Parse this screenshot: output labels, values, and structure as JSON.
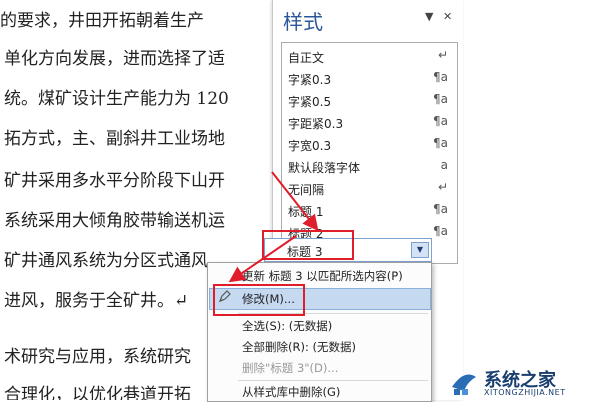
{
  "document": {
    "lines": [
      "的要求，井田开拓朝着生产",
      "单化方向发展，进而选择了适",
      "统。煤矿设计生产能力为 120",
      "拓方式，主、副斜井工业场地",
      "矿井采用多水平分阶段下山开",
      "系统采用大倾角胶带输送机运",
      "矿井通风系统为分区式通风",
      "进风，服务于全矿井。↵",
      "术研究与应用，系统研究",
      "合理化，以优化巷道开拓"
    ]
  },
  "styles_pane": {
    "title": "样式",
    "dropdown_glyph": "▼",
    "close_glyph": "✕",
    "items": [
      {
        "name": "自正文",
        "glyph": "↵"
      },
      {
        "name": "字紧0.3",
        "glyph": "¶a"
      },
      {
        "name": "字紧0.5",
        "glyph": "¶a"
      },
      {
        "name": "字距紧0.3",
        "glyph": "¶a"
      },
      {
        "name": "字宽0.3",
        "glyph": "¶a"
      },
      {
        "name": "默认段落字体",
        "glyph": "a"
      },
      {
        "name": "无间隔",
        "glyph": "↵"
      },
      {
        "name": "标题 1",
        "glyph": "¶a"
      },
      {
        "name": "标题 2",
        "glyph": "¶a"
      }
    ],
    "selected_item": {
      "name": "标题 3",
      "button_glyph": "▼"
    }
  },
  "context_menu": {
    "items": [
      {
        "label": "更新 标题 3 以匹配所选内容(P)",
        "disabled": false
      },
      {
        "label": "修改(M)...",
        "disabled": false,
        "highlighted": true
      },
      {
        "label": "全选(S): (无数据)",
        "disabled": false
      },
      {
        "label": "全部删除(R): (无数据)",
        "disabled": false
      },
      {
        "label": "删除\"标题 3\"(D)...",
        "disabled": true
      },
      {
        "label": "从样式库中删除(G)",
        "disabled": false
      }
    ]
  },
  "watermark": {
    "name": "系统之家",
    "url": "XITONGZHIJIA.NET"
  },
  "colors": {
    "annotation_red": "#e01e2b",
    "pane_title_blue": "#2b579a",
    "menu_highlight": "#c5d9f1"
  }
}
